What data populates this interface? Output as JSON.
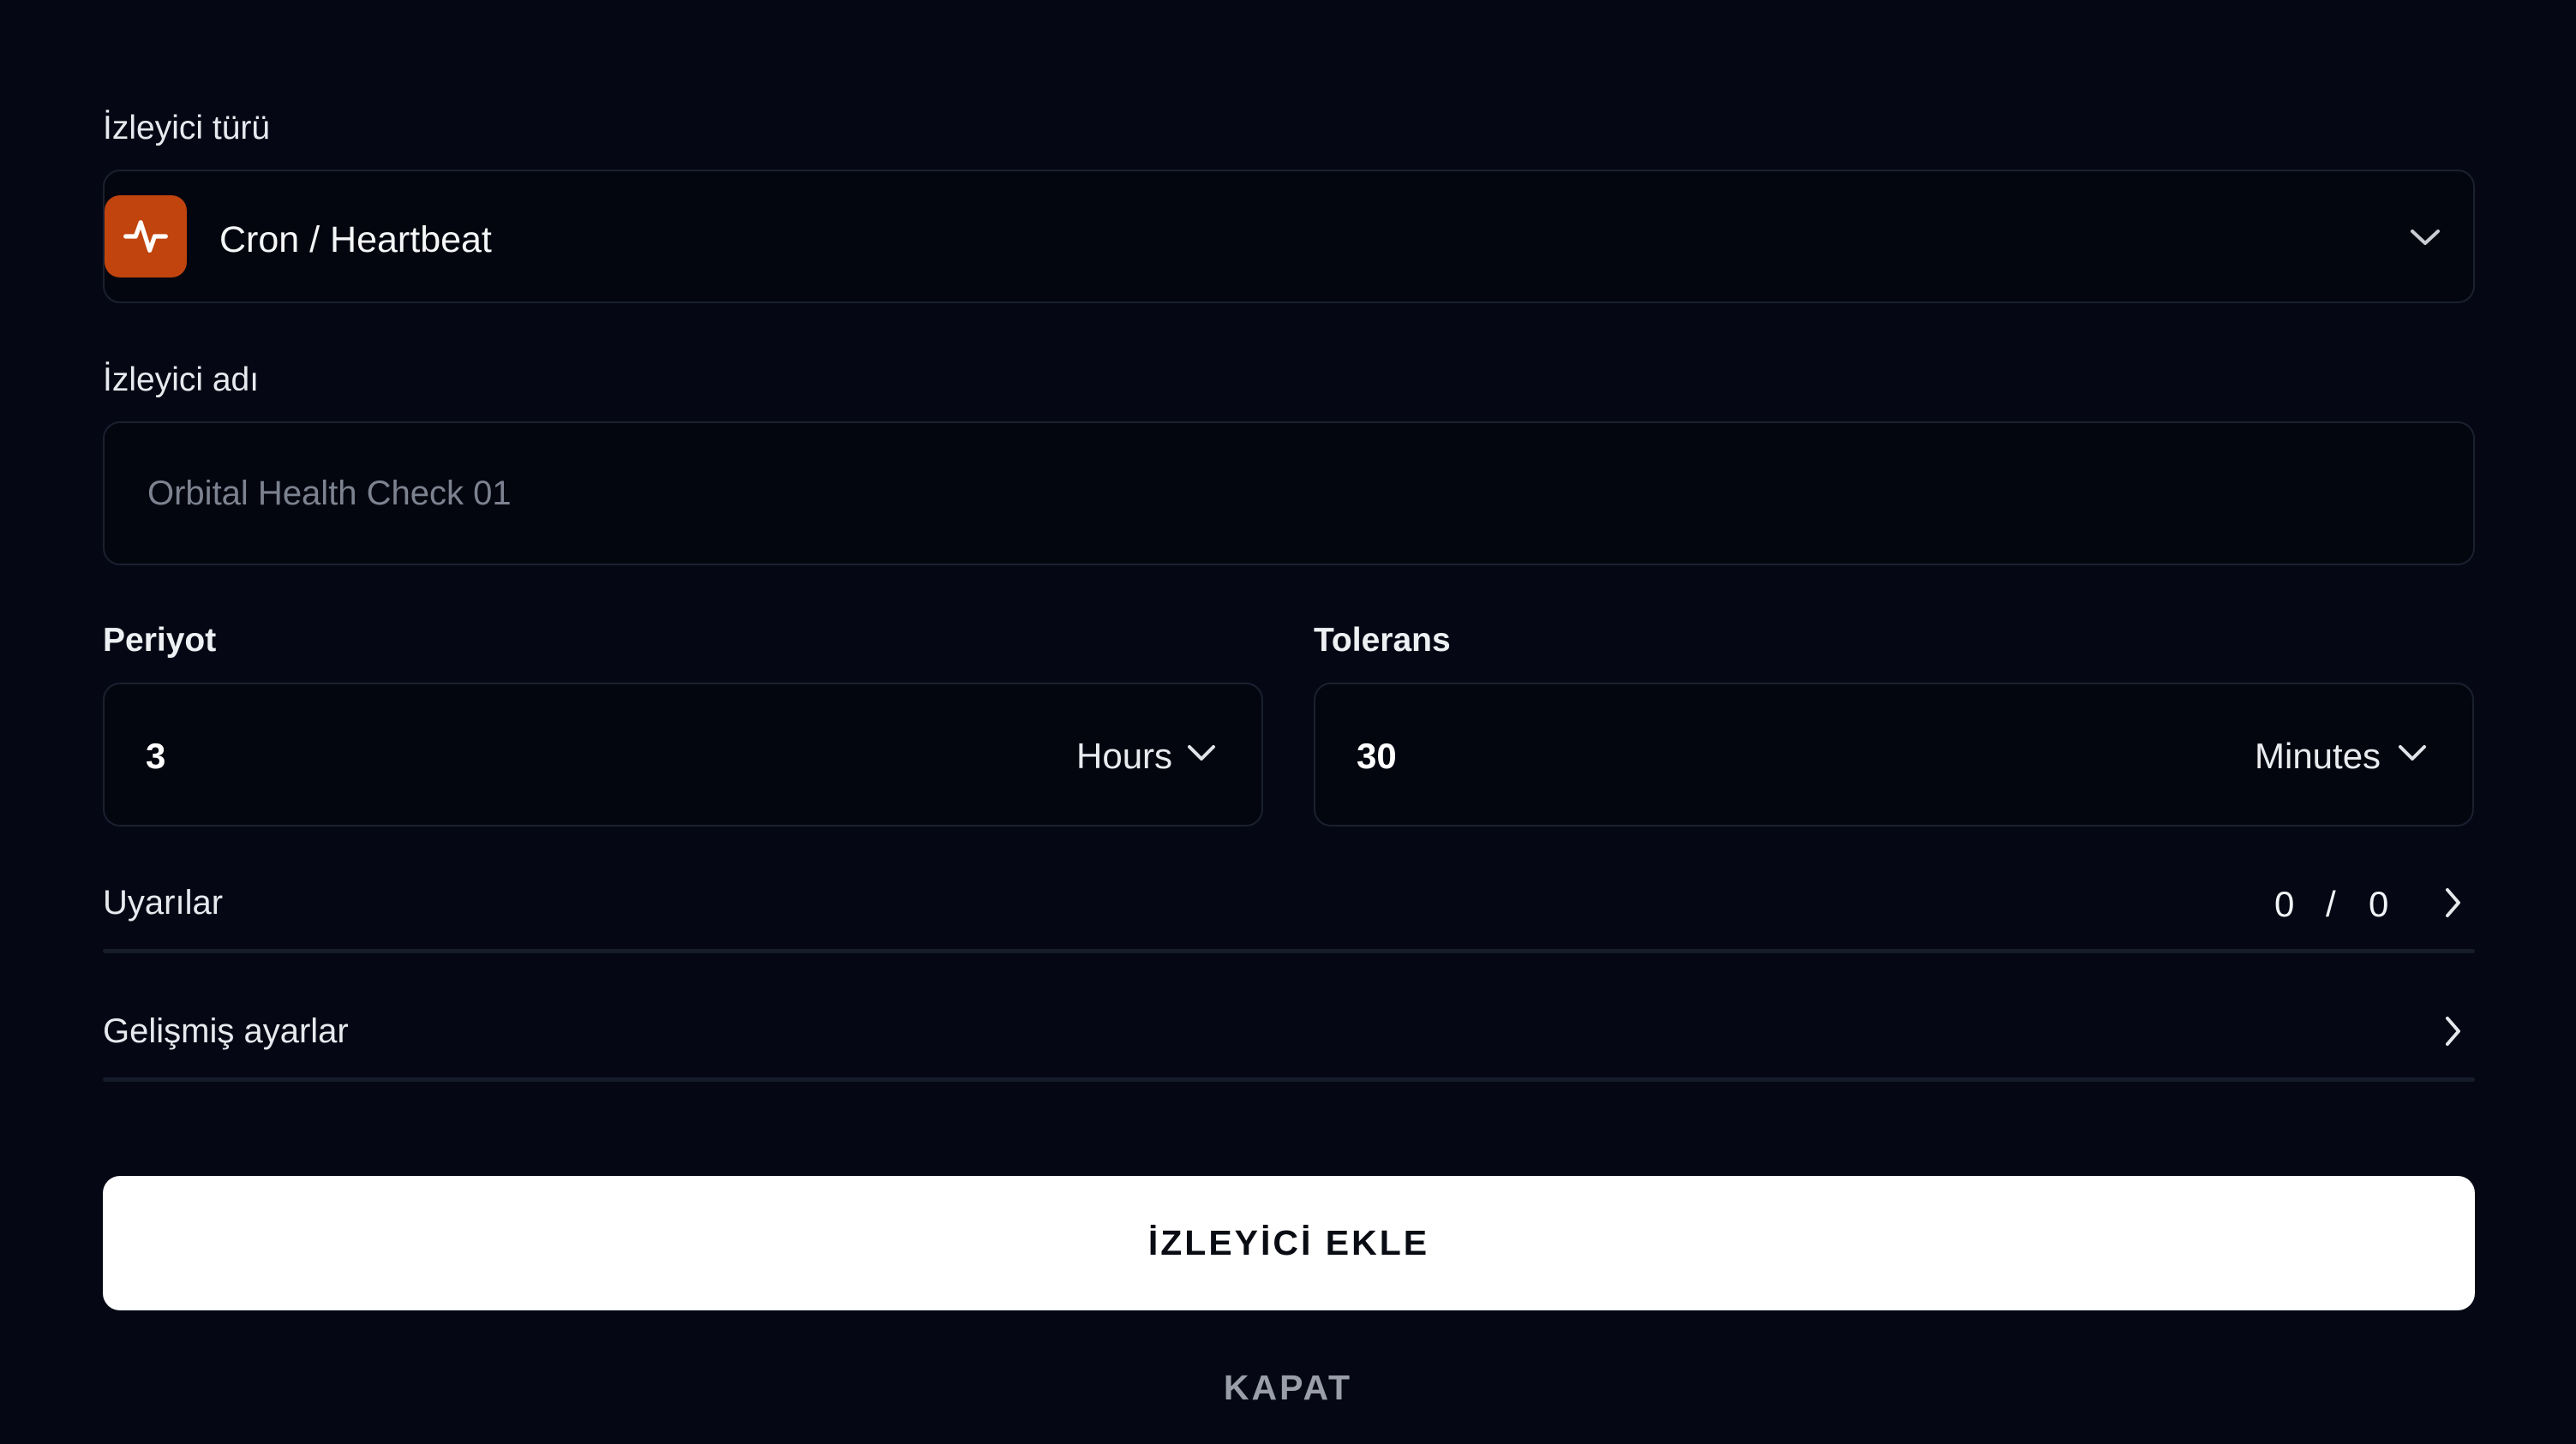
{
  "monitor_type": {
    "label": "İzleyici türü",
    "selected": "Cron / Heartbeat",
    "icon": "heartbeat-icon",
    "icon_color": "#c1440e"
  },
  "monitor_name": {
    "label": "İzleyici adı",
    "value": "",
    "placeholder": "Orbital Health Check 01"
  },
  "period": {
    "label": "Periyot",
    "value": "3",
    "unit": "Hours"
  },
  "tolerance": {
    "label": "Tolerans",
    "value": "30",
    "unit": "Minutes"
  },
  "alerts": {
    "label": "Uyarılar",
    "active": "0",
    "separator": "/",
    "total": "0"
  },
  "advanced": {
    "label": "Gelişmiş ayarlar"
  },
  "actions": {
    "add_label": "İZLEYİCİ EKLE",
    "close_label": "KAPAT"
  }
}
